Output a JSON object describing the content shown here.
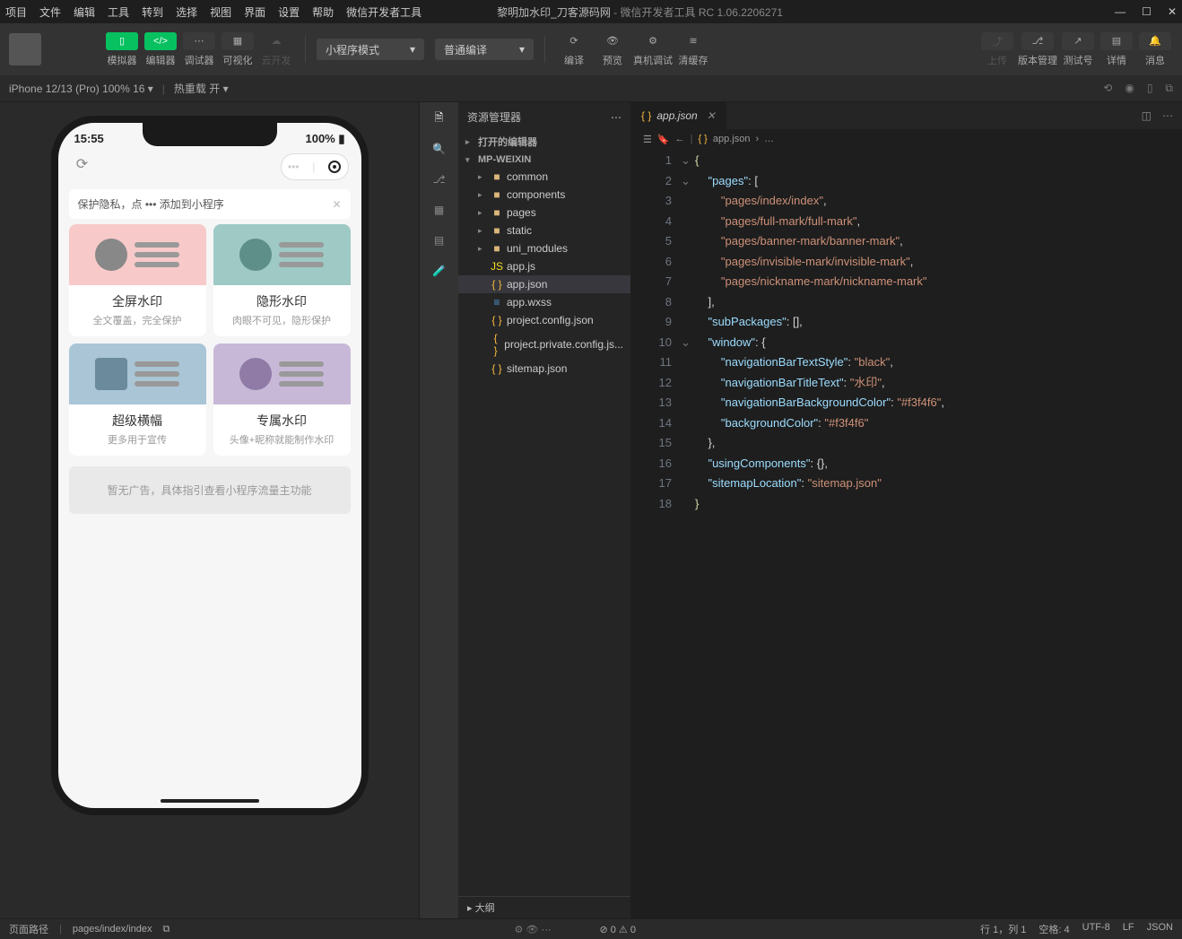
{
  "menubar": [
    "项目",
    "文件",
    "编辑",
    "工具",
    "转到",
    "选择",
    "视图",
    "界面",
    "设置",
    "帮助",
    "微信开发者工具"
  ],
  "title_project": "黎明加水印_刀客源码网",
  "title_app": " - 微信开发者工具 RC 1.06.2206271",
  "toolbar": {
    "simulator": "模拟器",
    "editor": "编辑器",
    "debugger": "调试器",
    "visualize": "可视化",
    "cloud": "云开发",
    "mode": "小程序模式",
    "compileMode": "普通编译",
    "compile": "编译",
    "preview": "预览",
    "realdebug": "真机调试",
    "clearcache": "清缓存",
    "upload": "上传",
    "version": "版本管理",
    "testnum": "测试号",
    "detail": "详情",
    "message": "消息"
  },
  "devicebar": {
    "device": "iPhone 12/13 (Pro) 100% 16",
    "hotreload": "热重载 开"
  },
  "phone": {
    "time": "15:55",
    "battery": "100%",
    "tip": "保护隐私，点 ••• 添加到小程序",
    "cards": [
      {
        "t": "全屏水印",
        "s": "全文覆盖，完全保护"
      },
      {
        "t": "隐形水印",
        "s": "肉眼不可见，隐形保护"
      },
      {
        "t": "超级横幅",
        "s": "更多用于宣传"
      },
      {
        "t": "专属水印",
        "s": "头像+昵称就能制作水印"
      }
    ],
    "ad": "暂无广告，具体指引查看小程序流量主功能"
  },
  "explorer": {
    "title": "资源管理器",
    "openEditors": "打开的编辑器",
    "root": "MP-WEIXIN",
    "folders": [
      "common",
      "components",
      "pages",
      "static",
      "uni_modules"
    ],
    "files": [
      "app.js",
      "app.json",
      "app.wxss",
      "project.config.json",
      "project.private.config.js...",
      "sitemap.json"
    ],
    "outline": "大纲"
  },
  "editor": {
    "tab": "app.json",
    "crumb": "app.json",
    "lines": [
      {
        "n": 1,
        "c": "<span class='s-b'>{</span>"
      },
      {
        "n": 2,
        "c": "    <span class='s-k'>\"pages\"</span><span class='s-p'>: [</span>"
      },
      {
        "n": 3,
        "c": "        <span class='s-s'>\"pages/index/index\"</span><span class='s-p'>,</span>"
      },
      {
        "n": 4,
        "c": "        <span class='s-s'>\"pages/full-mark/full-mark\"</span><span class='s-p'>,</span>"
      },
      {
        "n": 5,
        "c": "        <span class='s-s'>\"pages/banner-mark/banner-mark\"</span><span class='s-p'>,</span>"
      },
      {
        "n": 6,
        "c": "        <span class='s-s'>\"pages/invisible-mark/invisible-mark\"</span><span class='s-p'>,</span>"
      },
      {
        "n": 7,
        "c": "        <span class='s-s'>\"pages/nickname-mark/nickname-mark\"</span>"
      },
      {
        "n": 8,
        "c": "    <span class='s-p'>],</span>"
      },
      {
        "n": 9,
        "c": "    <span class='s-k'>\"subPackages\"</span><span class='s-p'>: [],</span>"
      },
      {
        "n": 10,
        "c": "    <span class='s-k'>\"window\"</span><span class='s-p'>: {</span>"
      },
      {
        "n": 11,
        "c": "        <span class='s-k'>\"navigationBarTextStyle\"</span><span class='s-p'>: </span><span class='s-s'>\"black\"</span><span class='s-p'>,</span>"
      },
      {
        "n": 12,
        "c": "        <span class='s-k'>\"navigationBarTitleText\"</span><span class='s-p'>: </span><span class='s-s'>\"水印\"</span><span class='s-p'>,</span>"
      },
      {
        "n": 13,
        "c": "        <span class='s-k'>\"navigationBarBackgroundColor\"</span><span class='s-p'>: </span><span class='s-s'>\"#f3f4f6\"</span><span class='s-p'>,</span>"
      },
      {
        "n": 14,
        "c": "        <span class='s-k'>\"backgroundColor\"</span><span class='s-p'>: </span><span class='s-s'>\"#f3f4f6\"</span>"
      },
      {
        "n": 15,
        "c": "    <span class='s-p'>},</span>"
      },
      {
        "n": 16,
        "c": "    <span class='s-k'>\"usingComponents\"</span><span class='s-p'>: {},</span>"
      },
      {
        "n": 17,
        "c": "    <span class='s-k'>\"sitemapLocation\"</span><span class='s-p'>: </span><span class='s-s'>\"sitemap.json\"</span>"
      },
      {
        "n": 18,
        "c": "<span class='s-b'>}</span>"
      }
    ]
  },
  "footer": {
    "pagePathLabel": "页面路径",
    "pagePath": "pages/index/index",
    "errors": "⊘ 0 ⚠ 0",
    "pos": "行 1，列 1",
    "spaces": "空格: 4",
    "enc": "UTF-8",
    "eol": "LF",
    "lang": "JSON"
  }
}
